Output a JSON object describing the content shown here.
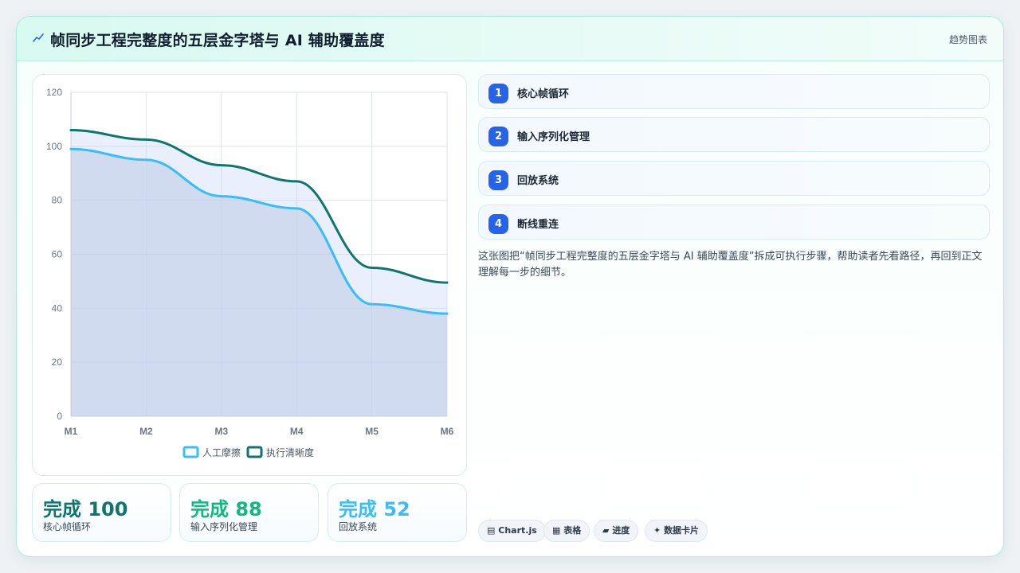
{
  "header": {
    "icon": "trend-icon",
    "title": "帧同步工程完整度的五层金字塔与 AI 辅助覆盖度",
    "tag": "趋势图表"
  },
  "chart_data": {
    "type": "area",
    "categories": [
      "M1",
      "M2",
      "M3",
      "M4",
      "M5",
      "M6"
    ],
    "series": [
      {
        "name": "人工摩擦",
        "values": [
          99,
          95,
          81.5,
          77,
          41.5,
          38
        ],
        "color": "#38bdf8"
      },
      {
        "name": "执行清晰度",
        "values": [
          106,
          102.5,
          93,
          87,
          55,
          49.5
        ],
        "color": "#0f766e"
      }
    ],
    "ylim": [
      0,
      120
    ],
    "yticks": [
      0,
      20,
      40,
      60,
      80,
      100,
      120
    ],
    "grid": true,
    "legend": "bottom"
  },
  "stats": [
    {
      "value": "完成 100",
      "label": "核心帧循环",
      "color": "#0f766e"
    },
    {
      "value": "完成 88",
      "label": "输入序列化管理",
      "color": "#10b981"
    },
    {
      "value": "完成 52",
      "label": "回放系统",
      "color": "#38bdf8"
    }
  ],
  "steps": [
    {
      "num": "1",
      "label": "核心帧循环"
    },
    {
      "num": "2",
      "label": "输入序列化管理"
    },
    {
      "num": "3",
      "label": "回放系统"
    },
    {
      "num": "4",
      "label": "断线重连"
    }
  ],
  "description": "这张图把“帧同步工程完整度的五层金字塔与 AI 辅助覆盖度”拆成可执行步骤，帮助读者先看路径，再回到正文理解每一步的细节。",
  "chips": [
    {
      "icon": "chart-icon",
      "glyph": "▤",
      "label": "Chart.js"
    },
    {
      "icon": "table-icon",
      "glyph": "▦",
      "label": "表格"
    },
    {
      "icon": "progress-icon",
      "glyph": "▰",
      "label": "进度"
    },
    {
      "icon": "sparkle-icon",
      "glyph": "✦",
      "label": "数据卡片"
    }
  ]
}
